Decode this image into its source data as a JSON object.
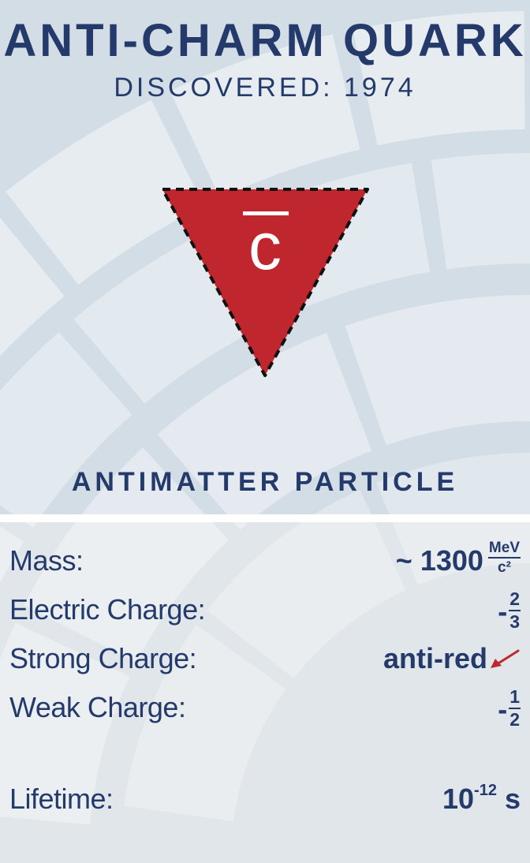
{
  "card": {
    "title": "ANTI-CHARM QUARK",
    "subtitle": "DISCOVERED: 1974",
    "symbol": {
      "letter": "c",
      "shape": "downward-triangle-icon",
      "fill_color": "#c0262d",
      "outline": "dashed"
    },
    "category": "ANTIMATTER PARTICLE"
  },
  "properties": {
    "mass": {
      "label": "Mass:",
      "value": "~ 1300",
      "unit_numerator": "MeV",
      "unit_denominator": "c²"
    },
    "electric_charge": {
      "label": "Electric Charge:",
      "sign": "-",
      "numerator": "2",
      "denominator": "3"
    },
    "strong_charge": {
      "label": "Strong Charge:",
      "value": "anti-red",
      "icon": "arrow-icon",
      "arrow_color": "#c0262d"
    },
    "weak_charge": {
      "label": "Weak Charge:",
      "sign": "-",
      "numerator": "1",
      "denominator": "2"
    },
    "lifetime": {
      "label": "Lifetime:",
      "base": "10",
      "exponent": "-12",
      "unit": "s"
    }
  },
  "colors": {
    "text": "#233a6b",
    "top_background": "#d3dde6",
    "bottom_background": "#e0e6ea",
    "accent_red": "#c0262d"
  }
}
